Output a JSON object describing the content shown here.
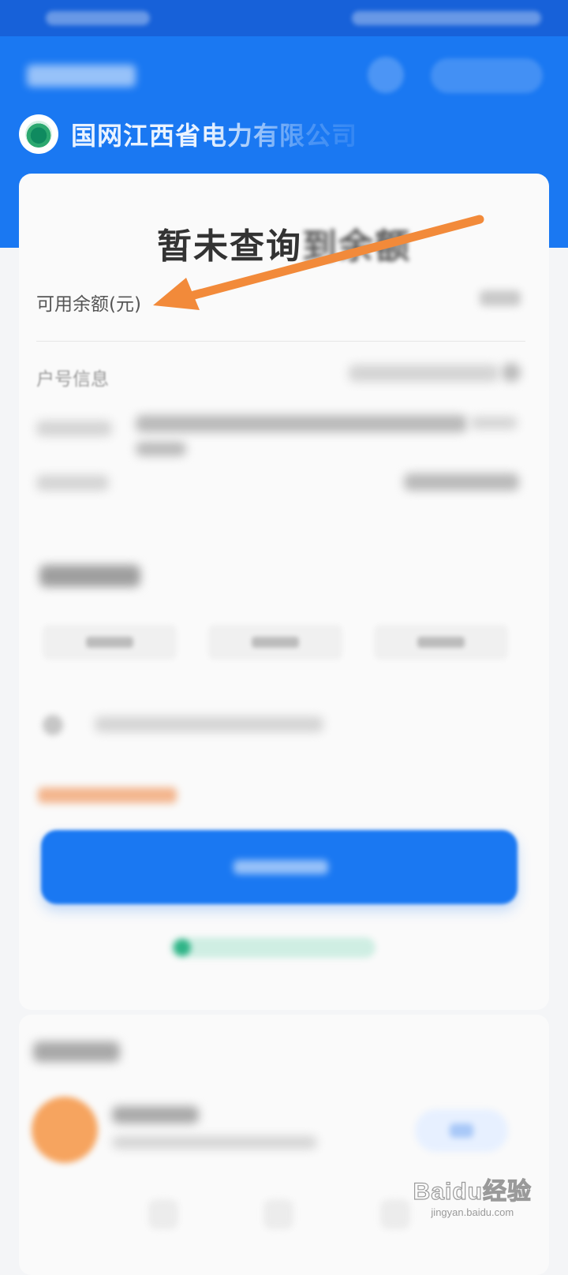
{
  "header": {
    "company_name": "国网江西省电力有限公司",
    "logo_icon": "state-grid-logo-icon",
    "brand_color": "#1A78F2"
  },
  "card": {
    "title_clear": "暂未查询",
    "title_blurred": "到余额",
    "balance_label": "可用余额(元)",
    "account_info_label": "户号信息"
  },
  "annotation": {
    "arrow_color": "#F28A3A",
    "arrow_icon": "pointer-arrow-icon"
  },
  "watermark": {
    "main": "Baidu经验",
    "sub": "jingyan.baidu.com"
  }
}
